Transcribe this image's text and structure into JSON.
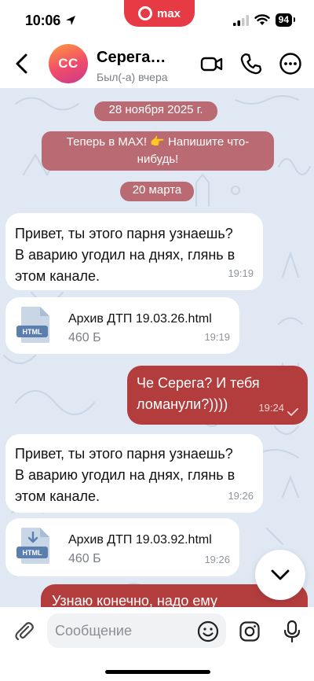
{
  "status_bar": {
    "time": "10:06",
    "battery": "94",
    "app_badge": "max"
  },
  "header": {
    "back_icon": "chevron-left-icon",
    "avatar_initials": "CC",
    "contact_name": "Серега…",
    "last_seen": "Был(-а) вчера",
    "icons": [
      "video-call-icon",
      "phone-icon",
      "more-icon"
    ]
  },
  "chat": {
    "date_1": "28 ноября 2025 г.",
    "system_message": "Теперь в MAX! 👉 Напишите что-нибудь!",
    "date_2": "20 марта",
    "messages": [
      {
        "type": "text",
        "direction": "in",
        "text": "Привет, ты этого парня узнаешь? В аварию угодил на днях, глянь в этом канале.",
        "time": "19:19"
      },
      {
        "type": "file",
        "direction": "in",
        "file_name": "Архив ДТП 19.03.26.html",
        "file_size": "460 Б",
        "file_badge": "HTML",
        "time": "19:19"
      },
      {
        "type": "text",
        "direction": "out",
        "text": "Че Серега? И тебя ломанули?))))",
        "time": "19:24",
        "status": "read"
      },
      {
        "type": "text",
        "direction": "in",
        "text": "Привет, ты этого парня узнаешь? В аварию угодил на днях, глянь в этом канале.",
        "time": "19:26"
      },
      {
        "type": "file",
        "direction": "in",
        "file_name": "Архив ДТП 19.03.92.html",
        "file_size": "460 Б",
        "file_badge": "HTML",
        "time": "19:26"
      },
      {
        "type": "text",
        "direction": "out",
        "text": "Узнаю конечно, надо ему",
        "partial": true
      }
    ]
  },
  "input": {
    "placeholder": "Сообщение"
  },
  "colors": {
    "accent_red": "#e63b45",
    "outgoing_bubble": "#b33d3d",
    "pill": "#b96a72",
    "chat_bg": "#dfe8f3"
  }
}
